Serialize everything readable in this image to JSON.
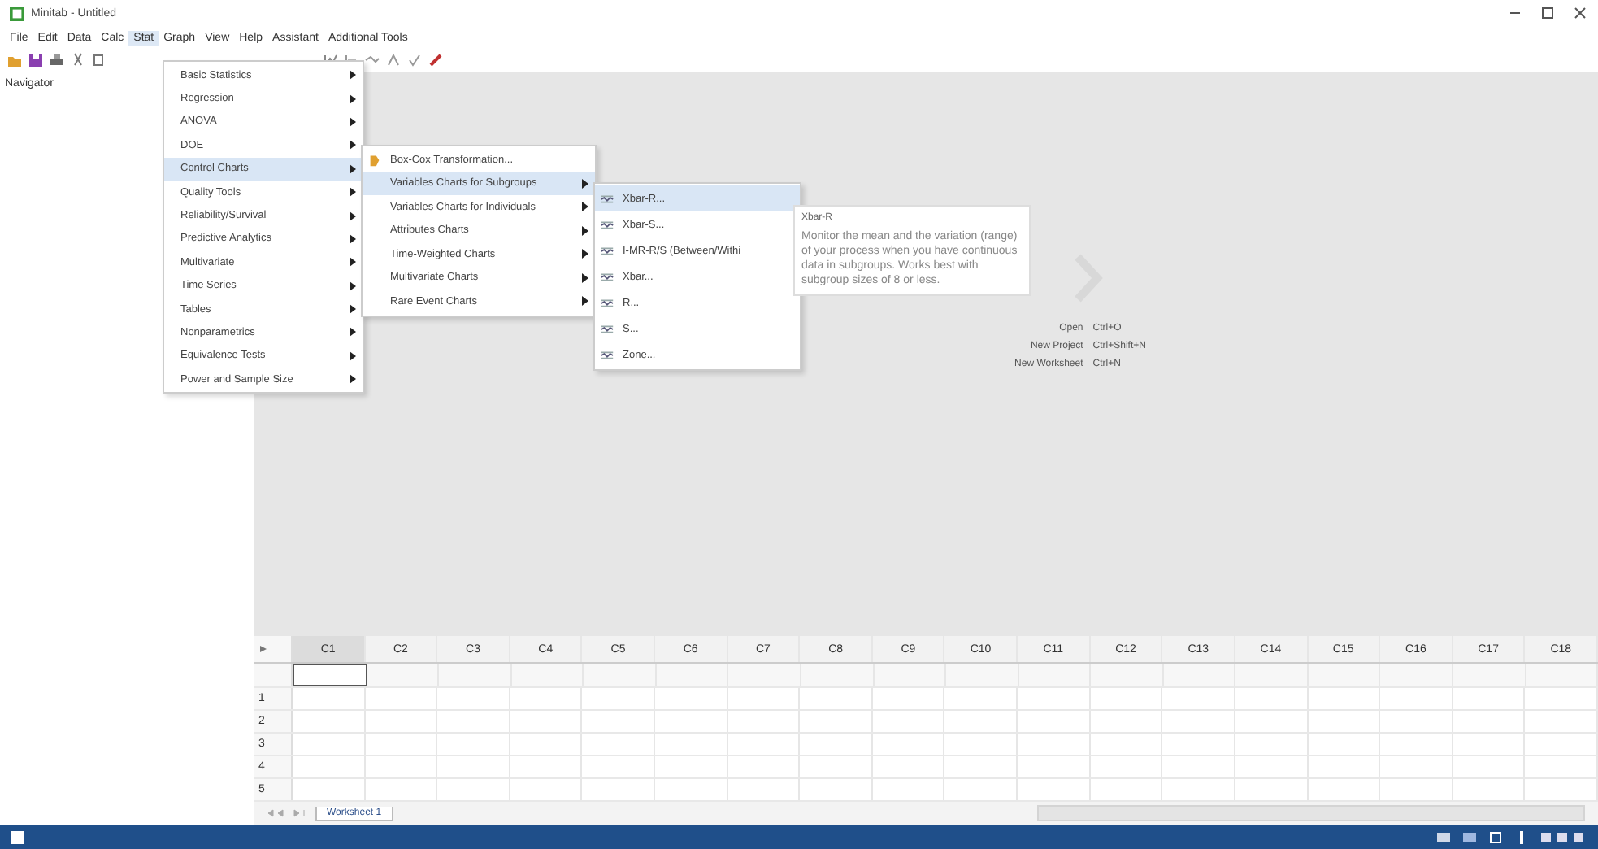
{
  "window": {
    "title": "Minitab - Untitled"
  },
  "menu_bar": [
    {
      "label": "File",
      "selected": false
    },
    {
      "label": "Edit",
      "selected": false
    },
    {
      "label": "Data",
      "selected": false
    },
    {
      "label": "Calc",
      "selected": false
    },
    {
      "label": "Stat",
      "selected": true
    },
    {
      "label": "Graph",
      "selected": false
    },
    {
      "label": "View",
      "selected": false
    },
    {
      "label": "Help",
      "selected": false
    },
    {
      "label": "Assistant",
      "selected": false
    },
    {
      "label": "Additional Tools",
      "selected": false
    }
  ],
  "navigator": {
    "title": "Navigator"
  },
  "stat_menu": [
    {
      "label": "Basic Statistics",
      "selected": false,
      "has_submenu": true
    },
    {
      "label": "Regression",
      "selected": false,
      "has_submenu": true
    },
    {
      "label": "ANOVA",
      "selected": false,
      "has_submenu": true
    },
    {
      "label": "DOE",
      "selected": false,
      "has_submenu": true
    },
    {
      "label": "Control Charts",
      "selected": true,
      "has_submenu": true
    },
    {
      "label": "Quality Tools",
      "selected": false,
      "has_submenu": true
    },
    {
      "label": "Reliability/Survival",
      "selected": false,
      "has_submenu": true
    },
    {
      "label": "Predictive Analytics",
      "selected": false,
      "has_submenu": true
    },
    {
      "label": "Multivariate",
      "selected": false,
      "has_submenu": true
    },
    {
      "label": "Time Series",
      "selected": false,
      "has_submenu": true
    },
    {
      "label": "Tables",
      "selected": false,
      "has_submenu": true
    },
    {
      "label": "Nonparametrics",
      "selected": false,
      "has_submenu": true
    },
    {
      "label": "Equivalence Tests",
      "selected": false,
      "has_submenu": true
    },
    {
      "label": "Power and Sample Size",
      "selected": false,
      "has_submenu": true
    }
  ],
  "control_charts_menu": [
    {
      "label": "Box-Cox Transformation...",
      "selected": false,
      "has_submenu": false,
      "icon": true
    },
    {
      "label": "Variables Charts for Subgroups",
      "selected": true,
      "has_submenu": true,
      "icon": false
    },
    {
      "label": "Variables Charts for Individuals",
      "selected": false,
      "has_submenu": true,
      "icon": false
    },
    {
      "label": "Attributes Charts",
      "selected": false,
      "has_submenu": true,
      "icon": false
    },
    {
      "label": "Time-Weighted Charts",
      "selected": false,
      "has_submenu": true,
      "icon": false
    },
    {
      "label": "Multivariate Charts",
      "selected": false,
      "has_submenu": true,
      "icon": false
    },
    {
      "label": "Rare Event Charts",
      "selected": false,
      "has_submenu": true,
      "icon": false
    }
  ],
  "subgroups_menu": [
    {
      "label": "Xbar-R...",
      "selected": true
    },
    {
      "label": "Xbar-S...",
      "selected": false
    },
    {
      "label": "I-MR-R/S (Between/Withi",
      "selected": false
    },
    {
      "label": "Xbar...",
      "selected": false
    },
    {
      "label": "R...",
      "selected": false
    },
    {
      "label": "S...",
      "selected": false
    },
    {
      "label": "Zone...",
      "selected": false
    }
  ],
  "tooltip": {
    "title": "Xbar-R",
    "text": "Monitor the mean and the variation (range) of your process when you have continuous data in subgroups. Works best with subgroup sizes of 8 or less."
  },
  "shortcuts": [
    {
      "label": "Open",
      "keys": "Ctrl+O"
    },
    {
      "label": "New Project",
      "keys": "Ctrl+Shift+N"
    },
    {
      "label": "New Worksheet",
      "keys": "Ctrl+N"
    }
  ],
  "worksheet": {
    "columns": [
      {
        "label": "C1",
        "selected": true
      },
      {
        "label": "C2",
        "selected": false
      },
      {
        "label": "C3",
        "selected": false
      },
      {
        "label": "C4",
        "selected": false
      },
      {
        "label": "C5",
        "selected": false
      },
      {
        "label": "C6",
        "selected": false
      },
      {
        "label": "C7",
        "selected": false
      },
      {
        "label": "C8",
        "selected": false
      },
      {
        "label": "C9",
        "selected": false
      },
      {
        "label": "C10",
        "selected": false
      },
      {
        "label": "C11",
        "selected": false
      },
      {
        "label": "C12",
        "selected": false
      },
      {
        "label": "C13",
        "selected": false
      },
      {
        "label": "C14",
        "selected": false
      },
      {
        "label": "C15",
        "selected": false
      },
      {
        "label": "C16",
        "selected": false
      },
      {
        "label": "C17",
        "selected": false
      },
      {
        "label": "C18",
        "selected": false
      }
    ],
    "rows": [
      "1",
      "2",
      "3",
      "4",
      "5"
    ]
  },
  "sheet_tabs": [
    {
      "label": "Worksheet 1",
      "selected": true
    }
  ]
}
